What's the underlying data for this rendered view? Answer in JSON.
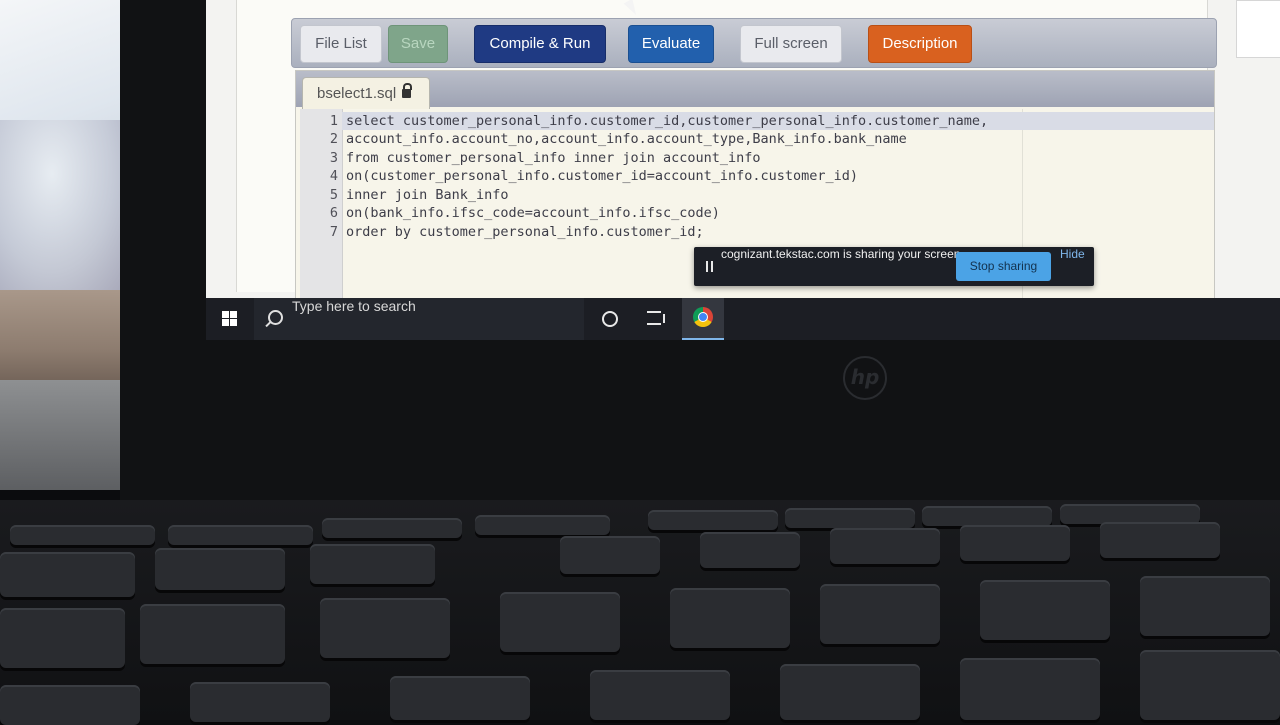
{
  "toolbar": {
    "file_list": "File List",
    "save": "Save",
    "compile_run": "Compile & Run",
    "evaluate": "Evaluate",
    "full_screen": "Full screen",
    "description": "Description"
  },
  "editor": {
    "tab_name": "bselect1.sql",
    "line_numbers": [
      "1",
      "2",
      "3",
      "4",
      "5",
      "6",
      "7"
    ],
    "lines": [
      "select customer_personal_info.customer_id,customer_personal_info.customer_name,",
      "account_info.account_no,account_info.account_type,Bank_info.bank_name",
      "from customer_personal_info inner join account_info",
      "on(customer_personal_info.customer_id=account_info.customer_id)",
      "inner join Bank_info",
      "on(bank_info.ifsc_code=account_info.ifsc_code)",
      "order by customer_personal_info.customer_id;"
    ]
  },
  "sharing": {
    "message": "cognizant.tekstac.com is sharing your screen.",
    "stop_label": "Stop sharing",
    "hide_label": "Hide"
  },
  "taskbar": {
    "search_placeholder": "Type here to search"
  },
  "colors": {
    "compile_run": "#1f3a83",
    "evaluate": "#2260ad",
    "description": "#d9611f",
    "save": "#7fa58a",
    "stop_sharing": "#4ba3e6"
  }
}
